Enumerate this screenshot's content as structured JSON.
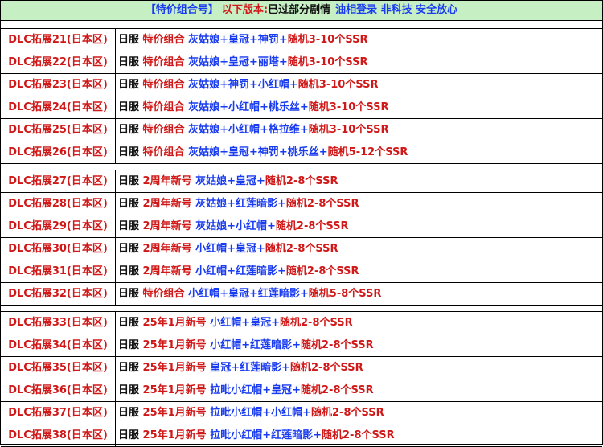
{
  "banner": {
    "part1": "【特价组合号】",
    "part2": "以下版本:",
    "part3": "已过部分剧情",
    "part4": "油相登录 非科技 安全放心"
  },
  "colors": {
    "red": "#d01818",
    "blue": "#1a3cf0",
    "banner_bg": "#c6f0c4"
  },
  "groups": [
    {
      "rows": [
        {
          "dlc": "DLC拓展21(日本区)",
          "server": "日服",
          "tag": "特价组合",
          "chars": "灰姑娘+皇冠+神罚+",
          "bonus": "随机3-10个SSR"
        },
        {
          "dlc": "DLC拓展22(日本区)",
          "server": "日服",
          "tag": "特价组合",
          "chars": "灰姑娘+皇冠+丽塔+",
          "bonus": "随机3-10个SSR"
        },
        {
          "dlc": "DLC拓展23(日本区)",
          "server": "日服",
          "tag": "特价组合",
          "chars": "灰姑娘+神罚+小红帽+",
          "bonus": "随机3-10个SSR"
        },
        {
          "dlc": "DLC拓展24(日本区)",
          "server": "日服",
          "tag": "特价组合",
          "chars": "灰姑娘+小红帽+桃乐丝+",
          "bonus": "随机3-10个SSR"
        },
        {
          "dlc": "DLC拓展25(日本区)",
          "server": "日服",
          "tag": "特价组合",
          "chars": "灰姑娘+小红帽+格拉维+",
          "bonus": "随机3-10个SSR"
        },
        {
          "dlc": "DLC拓展26(日本区)",
          "server": "日服",
          "tag": "特价组合",
          "chars": "灰姑娘+皇冠+神罚+桃乐丝+",
          "bonus": "随机5-12个SSR"
        }
      ]
    },
    {
      "rows": [
        {
          "dlc": "DLC拓展27(日本区)",
          "server": "日服",
          "tag": "2周年新号",
          "chars": "灰姑娘+皇冠+",
          "bonus": "随机2-8个SSR"
        },
        {
          "dlc": "DLC拓展28(日本区)",
          "server": "日服",
          "tag": "2周年新号",
          "chars": "灰姑娘+红莲暗影+",
          "bonus": "随机2-8个SSR"
        },
        {
          "dlc": "DLC拓展29(日本区)",
          "server": "日服",
          "tag": "2周年新号",
          "chars": "灰姑娘+小红帽+",
          "bonus": "随机2-8个SSR"
        },
        {
          "dlc": "DLC拓展30(日本区)",
          "server": "日服",
          "tag": "2周年新号",
          "chars": "小红帽+皇冠+",
          "bonus": "随机2-8个SSR"
        },
        {
          "dlc": "DLC拓展31(日本区)",
          "server": "日服",
          "tag": "2周年新号",
          "chars": "小红帽+红莲暗影+",
          "bonus": "随机2-8个SSR"
        },
        {
          "dlc": "DLC拓展32(日本区)",
          "server": "日服",
          "tag": "特价组合",
          "chars": "小红帽+皇冠+红莲暗影+",
          "bonus": "随机5-8个SSR"
        }
      ]
    },
    {
      "rows": [
        {
          "dlc": "DLC拓展33(日本区)",
          "server": "日服",
          "tag": "25年1月新号",
          "chars": "小红帽+皇冠+",
          "bonus": "随机2-8个SSR"
        },
        {
          "dlc": "DLC拓展34(日本区)",
          "server": "日服",
          "tag": "25年1月新号",
          "chars": "小红帽+红莲暗影+",
          "bonus": "随机2-8个SSR"
        },
        {
          "dlc": "DLC拓展35(日本区)",
          "server": "日服",
          "tag": "25年1月新号",
          "chars": "皇冠+红莲暗影+",
          "bonus": "随机2-8个SSR"
        },
        {
          "dlc": "DLC拓展36(日本区)",
          "server": "日服",
          "tag": "25年1月新号",
          "chars": "拉毗小红帽+皇冠+",
          "bonus": "随机2-8个SSR"
        },
        {
          "dlc": "DLC拓展37(日本区)",
          "server": "日服",
          "tag": "25年1月新号",
          "chars": "拉毗小红帽+小红帽+",
          "bonus": "随机2-8个SSR"
        },
        {
          "dlc": "DLC拓展38(日本区)",
          "server": "日服",
          "tag": "25年1月新号",
          "chars": "拉毗小红帽+红莲暗影+",
          "bonus": "随机2-8个SSR"
        }
      ]
    }
  ]
}
